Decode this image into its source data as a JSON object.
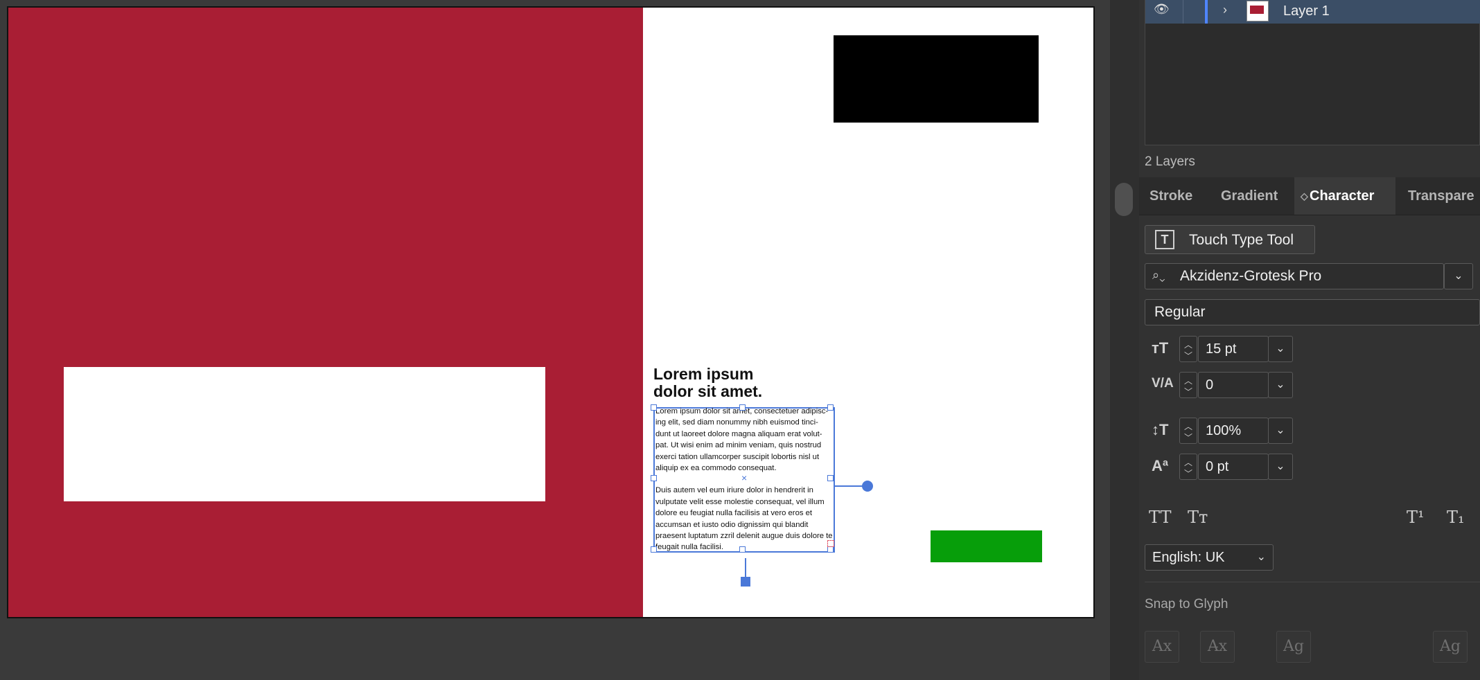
{
  "artboard": {
    "headline_line1": "Lorem ipsum",
    "headline_line2": "dolor sit amet.",
    "paragraph1": "Lorem ipsum dolor sit amet, consectetuer adipisc-ing elit, sed diam nonummy nibh euismod tinci-dunt ut laoreet dolore magna aliquam erat volut-pat. Ut wisi enim ad minim veniam, quis nostrud exerci tation ullamcorper suscipit lobortis nisl ut aliquip ex ea commodo consequat.",
    "paragraph2": "Duis autem vel eum iriure dolor in hendrerit in vulputate velit esse molestie consequat, vel illum dolore eu feugiat nulla facilisis at vero eros et accumsan et iusto odio dignissim qui blandit praesent luptatum zzril delenit augue duis dolore te feugait nulla facilisi.",
    "colors": {
      "red": "#a91e34",
      "black": "#000000",
      "green": "#079e0a",
      "selection": "#4a78d8"
    }
  },
  "layers": {
    "row_name": "Layer 1",
    "count": "2 Layers",
    "icons": {
      "visibility": "eye-icon",
      "expand": "chevron-right-icon"
    }
  },
  "tabs": [
    "Stroke",
    "Gradient",
    "Character",
    "Transpare"
  ],
  "character": {
    "touch_type_label": "Touch Type Tool",
    "font_family": "Akzidenz-Grotesk Pro",
    "font_style": "Regular",
    "font_size": "15 pt",
    "kerning": "0",
    "vertical_scale": "100%",
    "baseline_shift": "0 pt",
    "language": "English: UK",
    "snap_to_glyph": "Snap to Glyph"
  }
}
